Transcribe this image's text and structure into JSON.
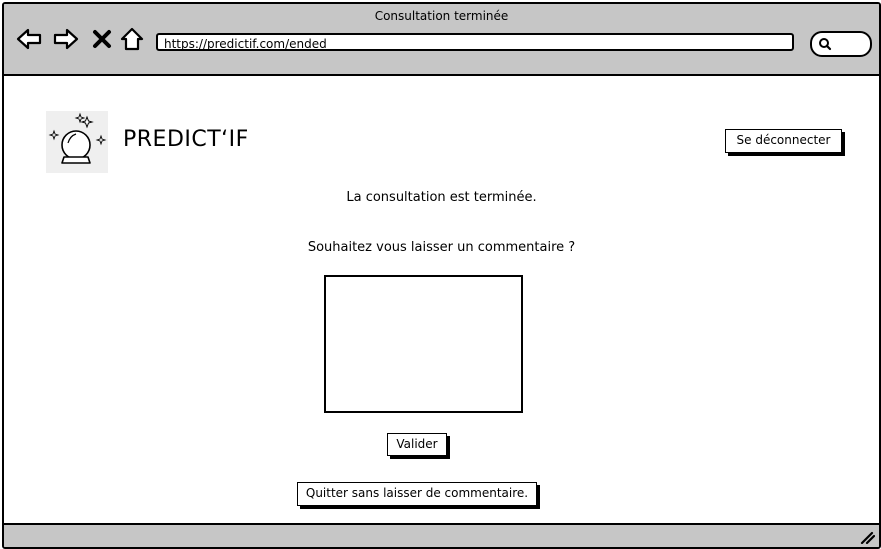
{
  "window": {
    "title": "Consultation terminée"
  },
  "browser": {
    "url": "https://predictif.com/ended",
    "icons": [
      "back-arrow-icon",
      "forward-arrow-icon",
      "close-icon",
      "home-icon",
      "search-icon"
    ]
  },
  "header": {
    "brand": "PREDICT‘IF",
    "logo_icon": "crystal-ball-icon",
    "logout_label": "Se déconnecter"
  },
  "main": {
    "ended_message": "La consultation est terminée.",
    "comment_prompt": "Souhaitez vous laisser un commentaire ?",
    "comment_value": "",
    "validate_label": "Valider",
    "quit_label": "Quitter sans laisser de commentaire."
  },
  "colors": {
    "chrome": "#c6c6c6",
    "border": "#000000",
    "background": "#ffffff"
  }
}
